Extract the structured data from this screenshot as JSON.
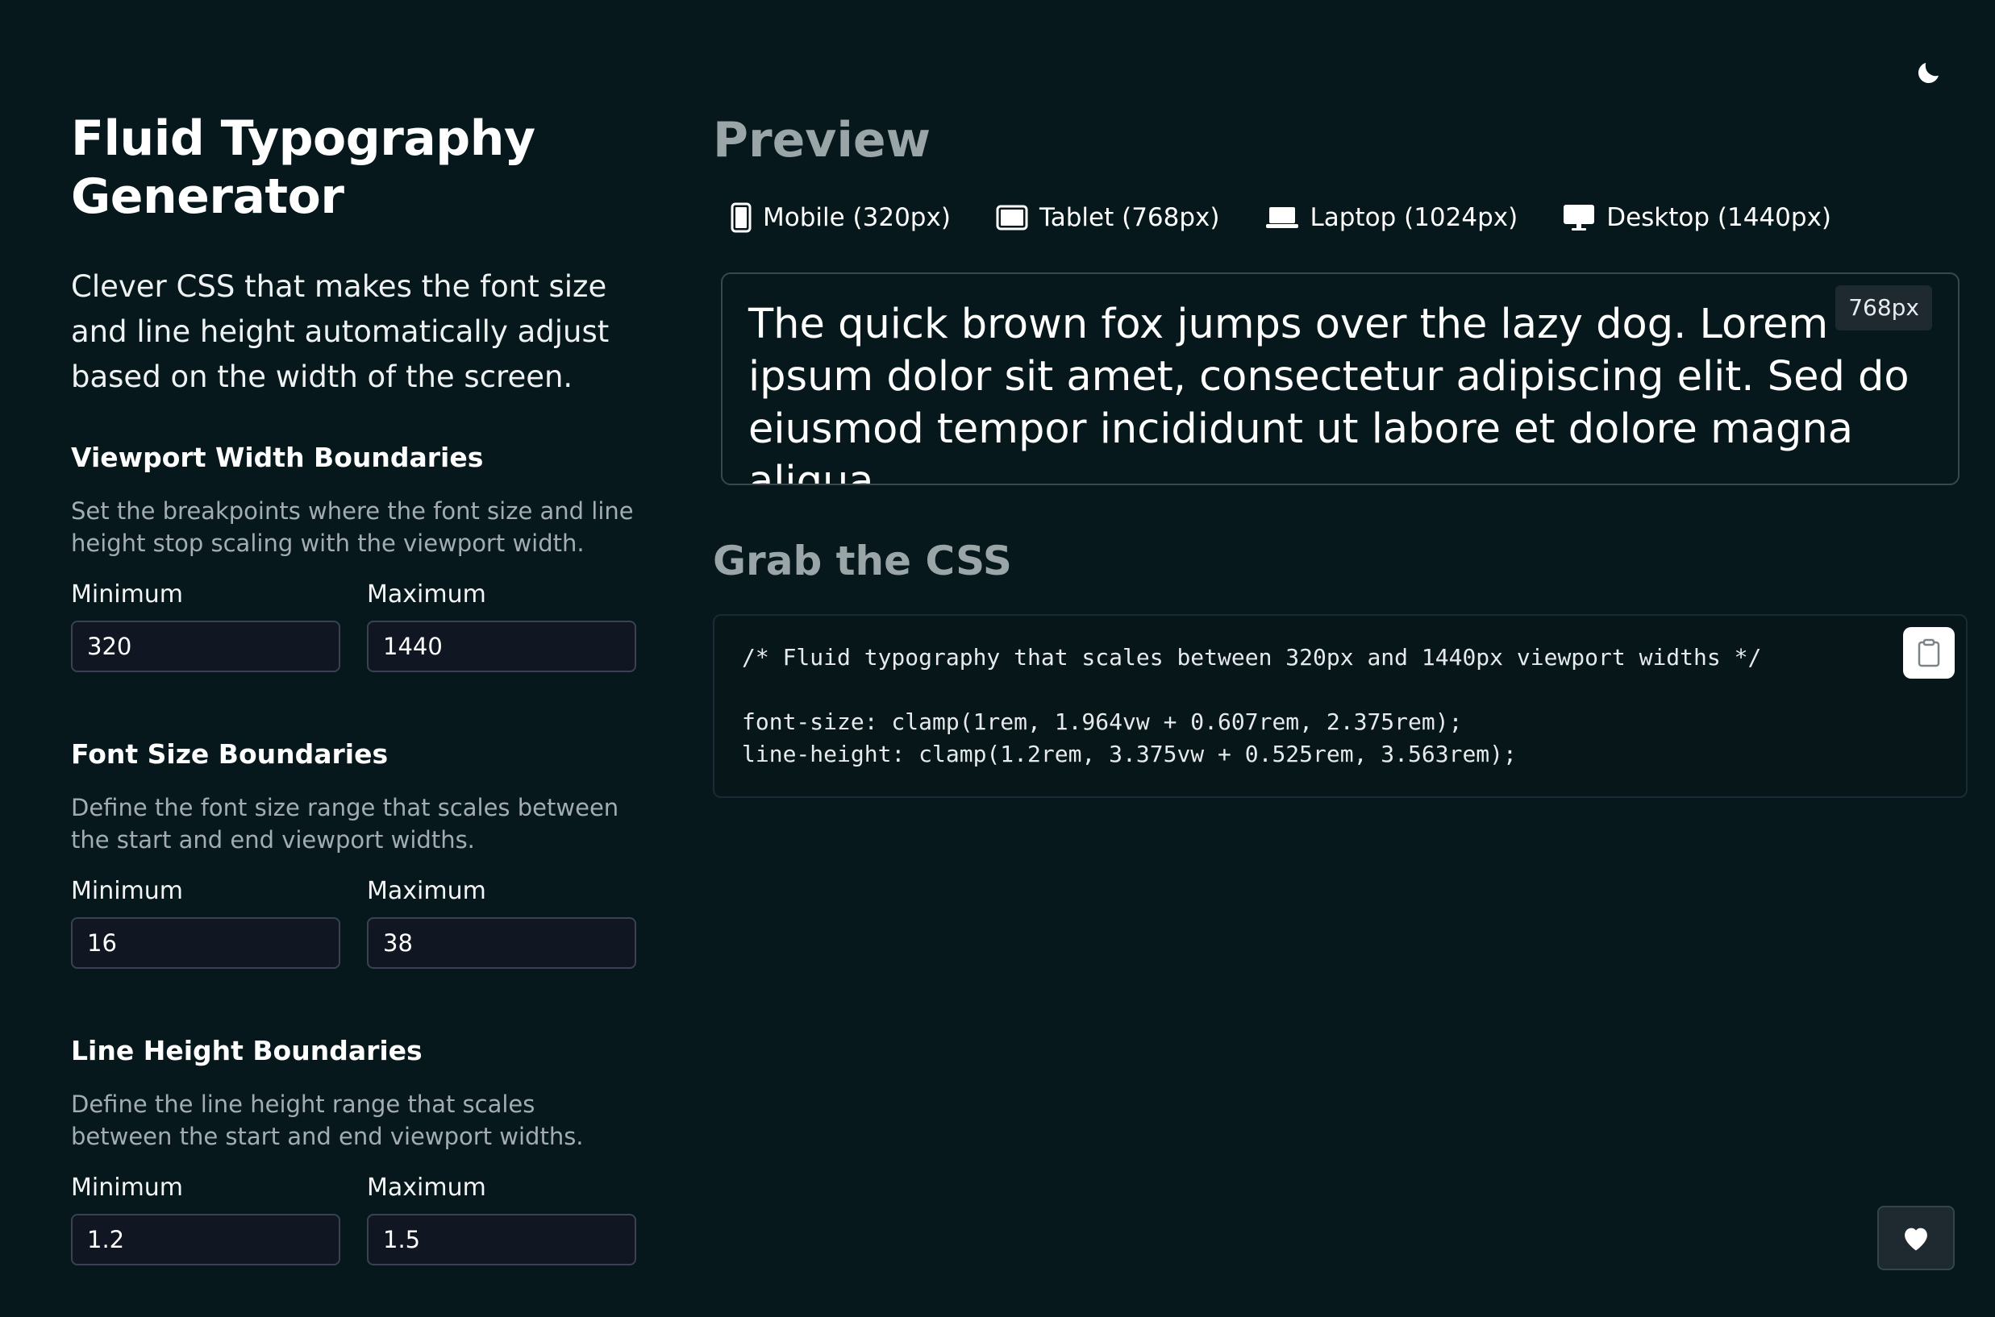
{
  "app": {
    "title": "Fluid Typography Generator",
    "description": "Clever CSS that makes the font size and line height automatically adjust based on the width of the screen."
  },
  "theme_toggle": {
    "icon": "moon-icon"
  },
  "sections": {
    "viewport": {
      "title": "Viewport Width Boundaries",
      "help": "Set the breakpoints where the font size and line height stop scaling with the viewport width.",
      "min_label": "Minimum",
      "max_label": "Maximum",
      "min_value": "320",
      "max_value": "1440"
    },
    "font_size": {
      "title": "Font Size Boundaries",
      "help": "Define the font size range that scales between the start and end viewport widths.",
      "min_label": "Minimum",
      "max_label": "Maximum",
      "min_value": "16",
      "max_value": "38"
    },
    "line_height": {
      "title": "Line Height Boundaries",
      "help": "Define the line height range that scales between the start and end viewport widths.",
      "min_label": "Minimum",
      "max_label": "Maximum",
      "min_value": "1.2",
      "max_value": "1.5"
    }
  },
  "preview": {
    "title": "Preview",
    "devices": [
      {
        "label": "Mobile (320px)",
        "icon": "mobile-icon"
      },
      {
        "label": "Tablet (768px)",
        "icon": "tablet-icon"
      },
      {
        "label": "Laptop (1024px)",
        "icon": "laptop-icon"
      },
      {
        "label": "Desktop (1440px)",
        "icon": "desktop-icon"
      }
    ],
    "sample_text": "The quick brown fox jumps over the lazy dog. Lorem ipsum dolor sit amet, consectetur adipiscing elit. Sed do eiusmod tempor incididunt ut labore et dolore magna aliqua.",
    "width_badge": "768px"
  },
  "css": {
    "title": "Grab the CSS",
    "code": "/* Fluid typography that scales between 320px and 1440px viewport widths */\n\nfont-size: clamp(1rem, 1.964vw + 0.607rem, 2.375rem);\nline-height: clamp(1.2rem, 3.375vw + 0.525rem, 3.563rem);",
    "copy_icon": "clipboard-icon"
  },
  "support": {
    "icon": "heart-icon"
  },
  "colors": {
    "background": "#06181c",
    "muted_heading": "#9aa5a8",
    "input_bg": "#101722"
  }
}
